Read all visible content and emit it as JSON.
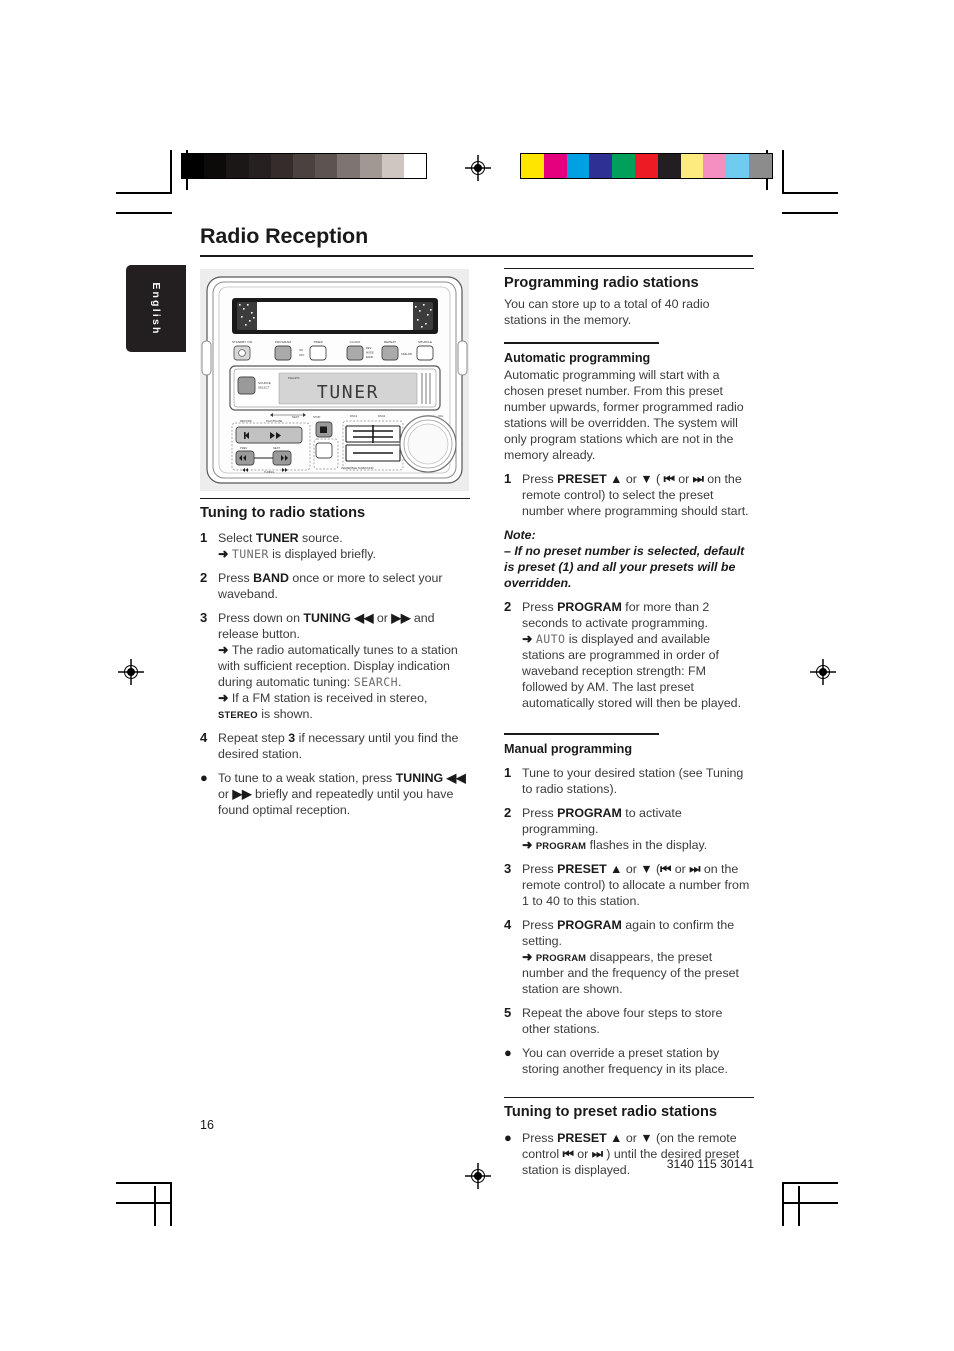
{
  "page": {
    "title": "Radio Reception",
    "language_tab": "English",
    "page_number": "16",
    "doc_code": "3140 115 30141"
  },
  "print_marks": {
    "grayscale_bar": [
      "#000000",
      "#0d0a0a",
      "#1c1717",
      "#262020",
      "#352d2b",
      "#4b4240",
      "#5d5350",
      "#7e7472",
      "#a19894",
      "#cfc6c2",
      "#ffffff"
    ],
    "colour_bar": [
      "#ffe500",
      "#e5007e",
      "#00a0e3",
      "#2e3192",
      "#00a05a",
      "#ed1c24",
      "#231f20",
      "#fdeb80",
      "#f58fc2",
      "#6fcbf0",
      "#8c8c8c"
    ]
  },
  "device_figure": {
    "display_text": "TUNER",
    "brand": "PHILIPS",
    "top_buttons": [
      "STANDBY·ON",
      "PROGRAM",
      "TIMER",
      "CLOCK",
      "REPEAT",
      "SHUFFLE"
    ],
    "top_button_sublabels": [
      "ON OFF",
      "REV MODE BAND",
      "SIDE A/B"
    ],
    "source_button": "SOURCE SELECT",
    "deck_labels": [
      "RECORD",
      "PLAY/PAUSE",
      "NEXT",
      "PREV",
      "STOP",
      "TUNING",
      "DSC1",
      "DSC2",
      "INCREDIBLE SURROUND",
      "VOL"
    ]
  },
  "left_column": {
    "heading": "Tuning to radio stations",
    "steps": [
      {
        "num": "1",
        "parts": [
          {
            "t": "Select "
          },
          {
            "t": "TUNER",
            "b": true
          },
          {
            "t": " source."
          }
        ],
        "sub": [
          {
            "arrow": true,
            "parts": [
              {
                "t": "TUNER",
                "lcd": true
              },
              {
                "t": " is displayed briefly."
              }
            ]
          }
        ]
      },
      {
        "num": "2",
        "parts": [
          {
            "t": "Press "
          },
          {
            "t": "BAND",
            "b": true
          },
          {
            "t": " once or more to select your waveband."
          }
        ],
        "sub": []
      },
      {
        "num": "3",
        "parts": [
          {
            "t": "Press down on "
          },
          {
            "t": "TUNING ◀◀",
            "b": true
          },
          {
            "t": " or "
          },
          {
            "t": "▶▶",
            "b": true
          },
          {
            "t": " and release button."
          }
        ],
        "sub": [
          {
            "arrow": true,
            "parts": [
              {
                "t": "The radio automatically tunes to a station with sufficient reception. Display indication during automatic tuning: "
              },
              {
                "t": "SEARCH",
                "lcd": true
              },
              {
                "t": "."
              }
            ]
          },
          {
            "arrow": true,
            "parts": [
              {
                "t": "If a FM station is received in stereo, "
              },
              {
                "t": "STEREO",
                "sc": true
              },
              {
                "t": " is shown."
              }
            ]
          }
        ]
      },
      {
        "num": "4",
        "parts": [
          {
            "t": "Repeat step "
          },
          {
            "t": "3",
            "b": true
          },
          {
            "t": " if necessary until you find the desired station."
          }
        ],
        "sub": []
      },
      {
        "num": "●",
        "parts": [
          {
            "t": "To tune to a weak station, press "
          },
          {
            "t": "TUNING ◀◀",
            "b": true
          },
          {
            "t": " or "
          },
          {
            "t": "▶▶",
            "b": true
          },
          {
            "t": " briefly and repeatedly until you have found optimal reception."
          }
        ],
        "sub": []
      }
    ]
  },
  "right_column": {
    "heading": "Programming radio stations",
    "intro": "You can store up to a total of 40 radio stations in the memory.",
    "auto": {
      "heading": "Automatic programming",
      "intro": "Automatic programming will start with a chosen preset number. From this preset number upwards, former programmed radio stations will be overridden. The system will only program stations which are not in the memory already.",
      "steps": [
        {
          "num": "1",
          "parts": [
            {
              "t": "Press "
            },
            {
              "t": "PRESET ▲",
              "b": true
            },
            {
              "t": " or "
            },
            {
              "t": "▼",
              "b": true
            },
            {
              "t": " ( "
            },
            {
              "t": "⏮",
              "b": true
            },
            {
              "t": " or "
            },
            {
              "t": "⏭",
              "b": true
            },
            {
              "t": " on the remote control) to select the preset number where programming should start."
            }
          ],
          "sub": []
        },
        {
          "num": "2",
          "parts": [
            {
              "t": "Press "
            },
            {
              "t": "PROGRAM",
              "b": true
            },
            {
              "t": " for more than 2 seconds to activate programming."
            }
          ],
          "sub": [
            {
              "arrow": true,
              "parts": [
                {
                  "t": "AUTO",
                  "lcd": true
                },
                {
                  "t": " is displayed and available stations are programmed in order of waveband reception strength: FM followed by AM. The last preset automatically stored will then be played."
                }
              ]
            }
          ]
        }
      ],
      "note": {
        "label": "Note:",
        "text": "–  If no preset number is selected, default is preset (1) and all your presets will be overridden."
      }
    },
    "manual": {
      "heading": "Manual programming",
      "steps": [
        {
          "num": "1",
          "parts": [
            {
              "t": "Tune to your desired station (see Tuning to radio stations)."
            }
          ],
          "sub": []
        },
        {
          "num": "2",
          "parts": [
            {
              "t": "Press "
            },
            {
              "t": "PROGRAM",
              "b": true
            },
            {
              "t": " to activate programming."
            }
          ],
          "sub": [
            {
              "arrow": true,
              "parts": [
                {
                  "t": "PROGRAM",
                  "sc": true
                },
                {
                  "t": " flashes in the display."
                }
              ]
            }
          ]
        },
        {
          "num": "3",
          "parts": [
            {
              "t": "Press "
            },
            {
              "t": "PRESET ▲",
              "b": true
            },
            {
              "t": " or "
            },
            {
              "t": "▼",
              "b": true
            },
            {
              "t": " ("
            },
            {
              "t": "⏮",
              "b": true
            },
            {
              "t": " or "
            },
            {
              "t": "⏭",
              "b": true
            },
            {
              "t": " on the remote control) to allocate a number from 1 to 40 to this station."
            }
          ],
          "sub": []
        },
        {
          "num": "4",
          "parts": [
            {
              "t": "Press "
            },
            {
              "t": "PROGRAM",
              "b": true
            },
            {
              "t": " again to confirm the setting."
            }
          ],
          "sub": [
            {
              "arrow": true,
              "parts": [
                {
                  "t": "PROGRAM",
                  "sc": true
                },
                {
                  "t": " disappears, the preset number and the frequency of the preset station are shown."
                }
              ]
            }
          ]
        },
        {
          "num": "5",
          "parts": [
            {
              "t": "Repeat the above four steps to store other stations."
            }
          ],
          "sub": []
        },
        {
          "num": "●",
          "parts": [
            {
              "t": "You can override a preset station by storing another frequency in its place."
            }
          ],
          "sub": []
        }
      ]
    },
    "preset": {
      "heading": "Tuning to preset radio stations",
      "steps": [
        {
          "num": "●",
          "parts": [
            {
              "t": "Press "
            },
            {
              "t": "PRESET ▲",
              "b": true
            },
            {
              "t": " or "
            },
            {
              "t": "▼",
              "b": true
            },
            {
              "t": " (on the remote control "
            },
            {
              "t": "⏮",
              "b": true
            },
            {
              "t": " or "
            },
            {
              "t": "⏭",
              "b": true
            },
            {
              "t": " ) until the desired preset station is displayed."
            }
          ],
          "sub": []
        }
      ]
    }
  }
}
